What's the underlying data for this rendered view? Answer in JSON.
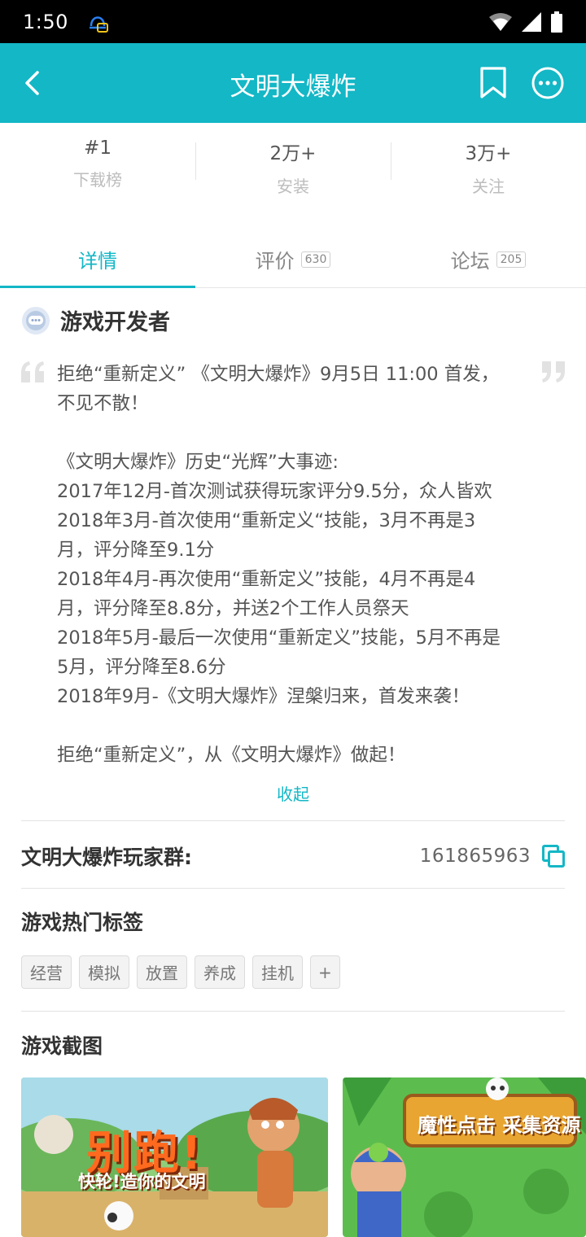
{
  "status_bar": {
    "time": "1:50"
  },
  "app_bar": {
    "title": "文明大爆炸"
  },
  "stats": [
    {
      "value": "#1",
      "label": "下载榜"
    },
    {
      "value": "2万+",
      "label": "安装"
    },
    {
      "value": "3万+",
      "label": "关注"
    }
  ],
  "tabs": [
    {
      "label": "详情",
      "count": ""
    },
    {
      "label": "评价",
      "count": "630"
    },
    {
      "label": "论坛",
      "count": "205"
    }
  ],
  "developer": {
    "title": "游戏开发者"
  },
  "description": {
    "lines": [
      "拒绝“重新定义” 《文明大爆炸》9月5日 11:00 首发，",
      "不见不散！",
      "",
      "《文明大爆炸》历史“光辉”大事迹:",
      "2017年12月-首次测试获得玩家评分9.5分，众人皆欢",
      "2018年3月-首次使用“重新定义“技能，3月不再是3",
      "月，评分降至9.1分",
      "2018年4月-再次使用“重新定义”技能，4月不再是4",
      "月，评分降至8.8分，并送2个工作人员祭天",
      "2018年5月-最后一次使用“重新定义”技能，5月不再是",
      "5月，评分降至8.6分",
      "2018年9月-《文明大爆炸》涅槃归来，首发来袭！",
      "",
      "拒绝“重新定义”，从《文明大爆炸》做起！"
    ],
    "collapse_label": "收起"
  },
  "player_group": {
    "label": "文明大爆炸玩家群:",
    "number": "161865963"
  },
  "hot_tags": {
    "title": "游戏热门标签",
    "items": [
      "经营",
      "模拟",
      "放置",
      "养成",
      "挂机"
    ],
    "more": "+"
  },
  "screenshots": {
    "title": "游戏截图",
    "items": [
      {
        "text": "别跑!",
        "sub": "快轮!造你的文明"
      },
      {
        "text": "魔性点击 采集资源"
      }
    ]
  },
  "colors": {
    "accent": "#13b7c6",
    "status_bar": "#000000"
  }
}
